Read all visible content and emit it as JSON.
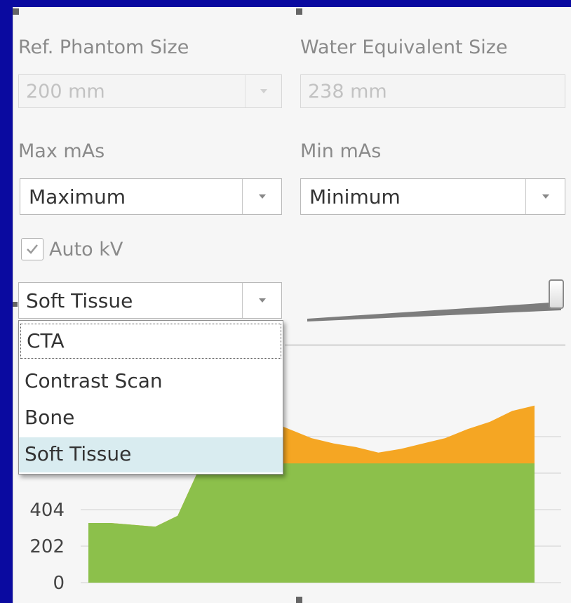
{
  "phantom": {
    "ref_label": "Ref. Phantom Size",
    "ref_value": "200  mm",
    "water_label": "Water Equivalent Size",
    "water_value": "238  mm"
  },
  "mas": {
    "max_label": "Max mAs",
    "max_value": "Maximum",
    "min_label": "Min mAs",
    "min_value": "Minimum"
  },
  "auto_kv": {
    "label": "Auto kV",
    "checked": true
  },
  "protocol": {
    "selected": "Soft Tissue",
    "options": [
      "CTA",
      "Contrast Scan",
      "Bone",
      "Soft Tissue"
    ],
    "slider_value": 1.0
  },
  "colors": {
    "orange": "#f5a623",
    "green": "#8cc04b"
  },
  "chart_data": {
    "type": "area",
    "y_tick_labels": [
      "404",
      "202",
      "0"
    ],
    "ylim": [
      0,
      1000
    ],
    "x": [
      0,
      5,
      10,
      15,
      20,
      25,
      30,
      35,
      40,
      45,
      50,
      55,
      60,
      65,
      70,
      75,
      80,
      85,
      90,
      95,
      100
    ],
    "series": [
      {
        "values": [
          330,
          330,
          320,
          310,
          370,
          640,
          720,
          800,
          900,
          850,
          800,
          770,
          750,
          720,
          740,
          770,
          800,
          850,
          890,
          950,
          980
        ]
      },
      {
        "values": [
          330,
          330,
          320,
          310,
          370,
          640,
          660,
          660,
          660,
          660,
          660,
          660,
          660,
          660,
          660,
          660,
          660,
          660,
          660,
          660,
          660
        ]
      }
    ]
  }
}
